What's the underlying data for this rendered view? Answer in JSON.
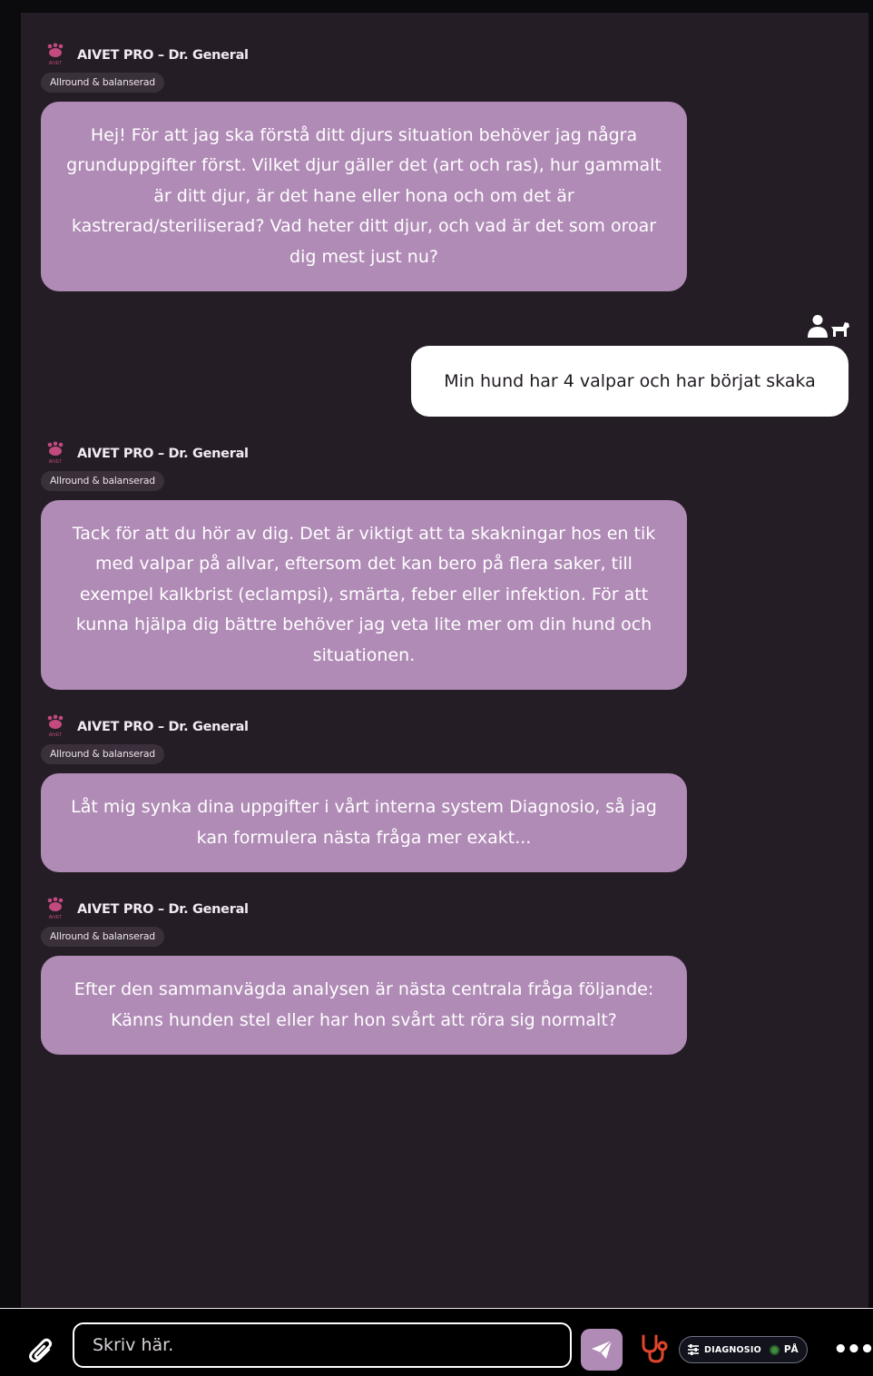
{
  "bot": {
    "name": "AIVET PRO – Dr. General",
    "badge": "Allround & balanserad",
    "logo_text": "AIVET"
  },
  "messages": [
    {
      "role": "bot",
      "text": "Hej! För att jag ska förstå ditt djurs situation behöver jag några grunduppgifter först. Vilket djur gäller det (art och ras), hur gammalt är ditt djur, är det hane eller hona och om det är kastrerad/steriliserad? Vad heter ditt djur, och vad är det som oroar dig mest just nu?"
    },
    {
      "role": "user",
      "text": "Min hund har 4 valpar och har börjat skaka"
    },
    {
      "role": "bot",
      "text": "Tack för att du hör av dig. Det är viktigt att ta skakningar hos en tik med valpar på allvar, eftersom det kan bero på flera saker, till exempel kalkbrist (eclampsi), smärta, feber eller infektion. För att kunna hjälpa dig bättre behöver jag veta lite mer om din hund och situationen."
    },
    {
      "role": "bot",
      "text": "Låt mig synka dina uppgifter i vårt interna system Diagnosio, så jag kan formulera nästa fråga mer exakt..."
    },
    {
      "role": "bot",
      "text": "Efter den sammanvägda analysen är nästa centrala fråga följande: Känns hunden stel eller har hon svårt att röra sig normalt?"
    }
  ],
  "input": {
    "placeholder": "Skriv här.",
    "value": ""
  },
  "diagnosio": {
    "label": "DIAGNOSIO",
    "state": "PÅ"
  },
  "icons": {
    "logo": "paw-icon",
    "user": "user-with-dog-icon",
    "attach": "paperclip-icon",
    "send": "paper-plane-icon",
    "stethoscope": "stethoscope-icon",
    "settings": "sliders-icon",
    "more": "more-icon"
  },
  "colors": {
    "bot_bubble": "#b08bb6",
    "user_bubble": "#ffffff",
    "panel": "#251d26",
    "logo": "#c24a7e",
    "stethoscope": "#e1462c",
    "status_on": "#3f8f3f"
  }
}
